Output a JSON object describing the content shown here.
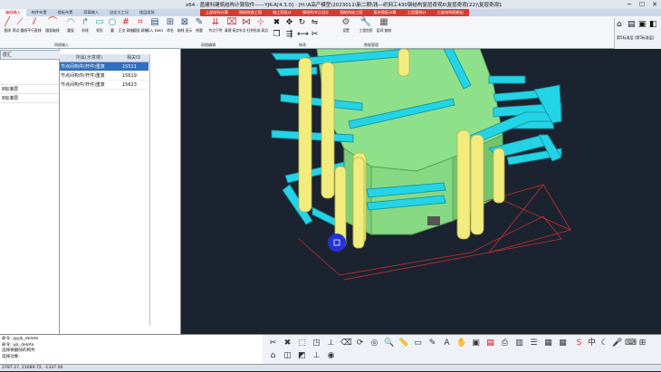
{
  "window": {
    "title": "x64 - 盈建科建筑结构计算软件——YJK-A[4.3.0] - [H:\\A高产模型\\2023011\\新二期\\钱—织网工430钢结构复层奇观6\\复层奇观(22)\\复层奇观1",
    "minimize": "─",
    "maximize": "☐",
    "close": "✕"
  },
  "tabs": [
    {
      "label": "轴网输入"
    },
    {
      "label": "构件布置"
    },
    {
      "label": "楼板布置"
    },
    {
      "label": "荷载输入"
    },
    {
      "label": "自定义工况"
    },
    {
      "label": "楼层组装"
    },
    {
      "label": "上部结构计算"
    },
    {
      "label": "钢结构施工图"
    },
    {
      "label": "施工图设计"
    },
    {
      "label": "钢结构节点设计"
    },
    {
      "label": "钢结构施工图"
    },
    {
      "label": "复杂楼板计算"
    },
    {
      "label": "工程量统计"
    },
    {
      "label": "三维结构图输出"
    }
  ],
  "ribbon": {
    "buttons": [
      {
        "label": "直线"
      },
      {
        "label": "两点\n圆线"
      },
      {
        "label": "平行直线"
      },
      {
        "label": "圆弧轴线"
      },
      {
        "label": "圆弧"
      },
      {
        "label": "折线"
      },
      {
        "label": "矩形"
      },
      {
        "label": "圆"
      },
      {
        "label": "正交\n网格"
      },
      {
        "label": "圆弧\n网格"
      },
      {
        "label": "导入\nDWG"
      },
      {
        "label": "命名"
      },
      {
        "label": "轴线\n显示"
      },
      {
        "label": "修整"
      },
      {
        "label": "节点下传"
      },
      {
        "label": "清理\n网点"
      },
      {
        "label": "节点\n归并"
      },
      {
        "label": "形成\n网点"
      },
      {
        "label": "设置"
      },
      {
        "label": "工程信息"
      },
      {
        "label": "层间\n复制"
      }
    ],
    "groups": [
      "网格输入",
      "网格编辑",
      "修改",
      "数据管理"
    ],
    "right_label": "第5标准层 (第5标准层)"
  },
  "left_panel": {
    "dialog_title": "层汇",
    "items": [
      "",
      "8标准层",
      "8标准层"
    ]
  },
  "table": {
    "headers": [
      "所属(示意楼)",
      "相关ID"
    ],
    "rows": [
      {
        "name": "节点间构件(杆件)重复",
        "id": "15511",
        "selected": true
      },
      {
        "name": "节点间构件(杆件)重复",
        "id": "15619",
        "selected": false
      },
      {
        "name": "节点间构件(杆件)重复",
        "id": "15623",
        "selected": false
      }
    ]
  },
  "command": {
    "lines": [
      "命令: @yjk_delete",
      "命令: yjk_delete",
      "选择要删除的构件",
      "选择对象:"
    ]
  },
  "status": {
    "coords": "2787.27, 21689.72, -1337.00"
  },
  "colors": {
    "beam": "#22d4e6",
    "column": "#f2ec7e",
    "slab": "#8ee08a",
    "background_3d": "#1c2330"
  }
}
